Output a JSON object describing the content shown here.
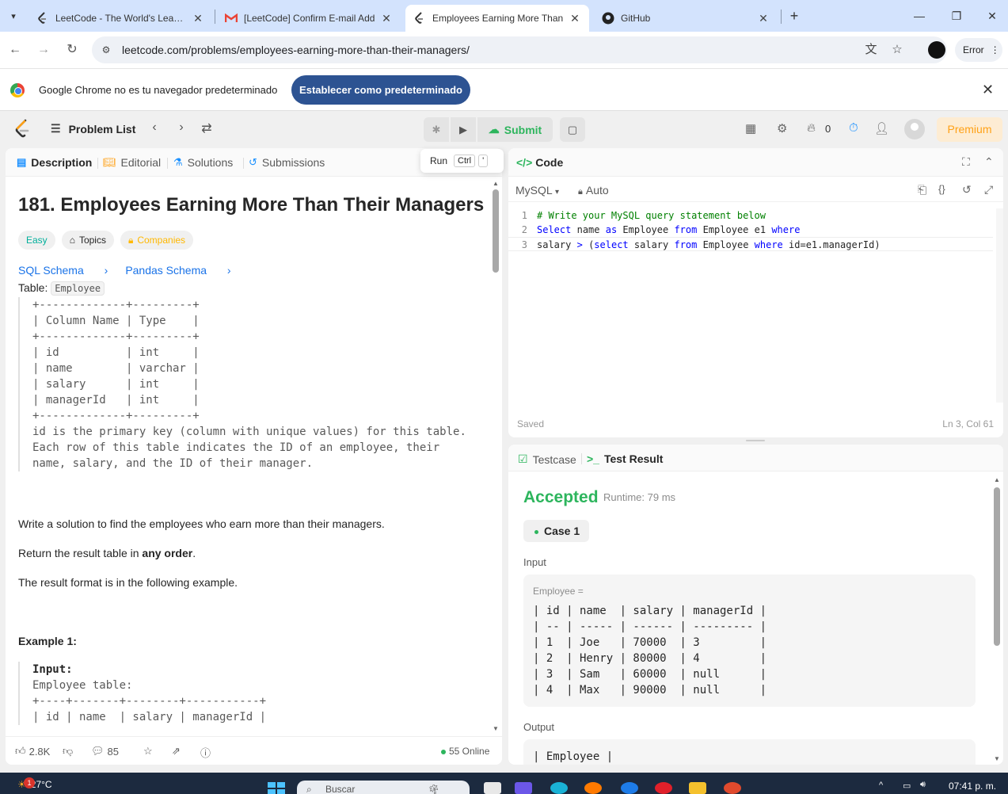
{
  "browser": {
    "tabs": [
      {
        "title": "LeetCode - The World's Leading",
        "active": false
      },
      {
        "title": "[LeetCode] Confirm E-mail Add",
        "active": false
      },
      {
        "title": "Employees Earning More Than",
        "active": true
      },
      {
        "title": "GitHub",
        "active": false
      }
    ],
    "url": "leetcode.com/problems/employees-earning-more-than-their-managers/",
    "profile_button": "Error"
  },
  "infobar": {
    "message": "Google Chrome no es tu navegador predeterminado",
    "button": "Establecer como predeterminado"
  },
  "lc_nav": {
    "problem_list": "Problem List",
    "submit": "Submit",
    "streak": "0",
    "premium": "Premium",
    "run_tooltip": {
      "label": "Run",
      "key1": "Ctrl",
      "key2": "'"
    }
  },
  "left": {
    "tabs": [
      "Description",
      "Editorial",
      "Solutions",
      "Submissions"
    ],
    "title": "181. Employees Earning More Than Their Managers",
    "difficulty": "Easy",
    "topics": "Topics",
    "companies": "Companies",
    "schemas": [
      "SQL Schema",
      "Pandas Schema"
    ],
    "table_prefix": "Table:",
    "table_name": "Employee",
    "schema_block": "+-------------+---------+\n| Column Name | Type    |\n+-------------+---------+\n| id          | int     |\n| name        | varchar |\n| salary      | int     |\n| managerId   | int     |\n+-------------+---------+\nid is the primary key (column with unique values) for this table.\nEach row of this table indicates the ID of an employee, their\nname, salary, and the ID of their manager.",
    "para1": "Write a solution to find the employees who earn more than their managers.",
    "para2_pre": "Return the result table in ",
    "para2_bold": "any order",
    "para2_post": ".",
    "para3": "The result format is in the following example.",
    "example_title": "Example 1:",
    "example_block": "Employee table:\n+----+-------+--------+-----------+\n| id | name  | salary | managerId |",
    "example_input": "Input:",
    "footer": {
      "likes": "2.8K",
      "comments": "85",
      "online": "55 Online"
    }
  },
  "code": {
    "header": "Code",
    "language": "MySQL",
    "mode": "Auto",
    "lines": [
      {
        "n": "1",
        "text": "# Write your MySQL query statement below"
      },
      {
        "n": "2",
        "text": "Select name as Employee from Employee e1 where"
      },
      {
        "n": "3",
        "text": "salary > (select salary from Employee where id=e1.managerId)"
      }
    ],
    "status": "Saved",
    "position": "Ln 3, Col 61"
  },
  "test": {
    "tabs": [
      "Testcase",
      "Test Result"
    ],
    "verdict": "Accepted",
    "runtime": "Runtime: 79 ms",
    "case": "Case 1",
    "input_label": "Input",
    "input_var": "Employee =",
    "input_table": "| id | name  | salary | managerId |\n| -- | ----- | ------ | --------- |\n| 1  | Joe   | 70000  | 3         |\n| 2  | Henry | 80000  | 4         |\n| 3  | Sam   | 60000  | null      |\n| 4  | Max   | 90000  | null      |",
    "output_label": "Output",
    "output_table": "| Employee |"
  },
  "taskbar": {
    "temperature": "27°C",
    "badge": "1",
    "search": "Buscar",
    "time": "07:41 p. m."
  }
}
